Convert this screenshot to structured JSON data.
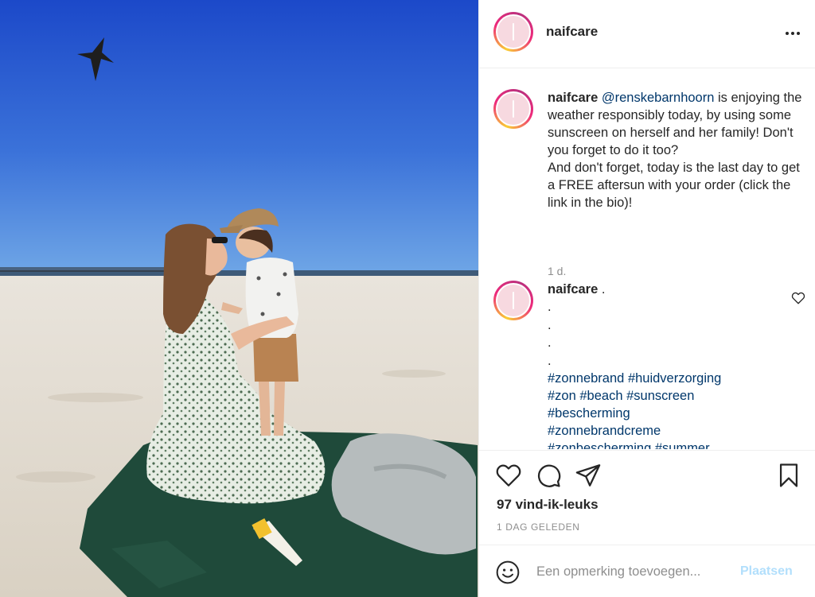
{
  "post": {
    "username": "naifcare",
    "image_alt": "Woman and young boy on a sunny beach sitting on a green blanket"
  },
  "caption": {
    "username": "naifcare",
    "mention": "@renskebarnhoorn",
    "text": " is enjoying the weather responsibly today, by using some sunscreen on herself and her family! Don't you forget to do it too?\nAnd don't forget, today is the last day to get a FREE aftersun with your order (click the link in the bio)!",
    "time": "1 d."
  },
  "comment": {
    "username": "naifcare",
    "text": " .",
    "dots": [
      ".",
      ".",
      ".",
      "."
    ],
    "hashtag_lines": [
      [
        "#zonnebrand",
        "#huidverzorging"
      ],
      [
        "#zon",
        "#beach",
        "#sunscreen"
      ],
      [
        "#bescherming"
      ],
      [
        "#zonnebrandcreme"
      ],
      [
        "#zonbescherming",
        "#summer"
      ]
    ]
  },
  "actions": {
    "likes": "97 vind-ik-leuks",
    "date": "1 DAG GELEDEN"
  },
  "compose": {
    "placeholder": "Een opmerking toevoegen...",
    "post_label": "Plaatsen"
  },
  "icons": {
    "like": "heart-icon",
    "comment": "speech-bubble-icon",
    "share": "paper-plane-icon",
    "save": "bookmark-icon",
    "more": "more-options-icon",
    "emoji": "smiley-icon"
  },
  "colors": {
    "link": "#00376b",
    "muted": "#8e8e8e",
    "post_button_disabled": "#b2dffc",
    "border": "#efefef"
  }
}
